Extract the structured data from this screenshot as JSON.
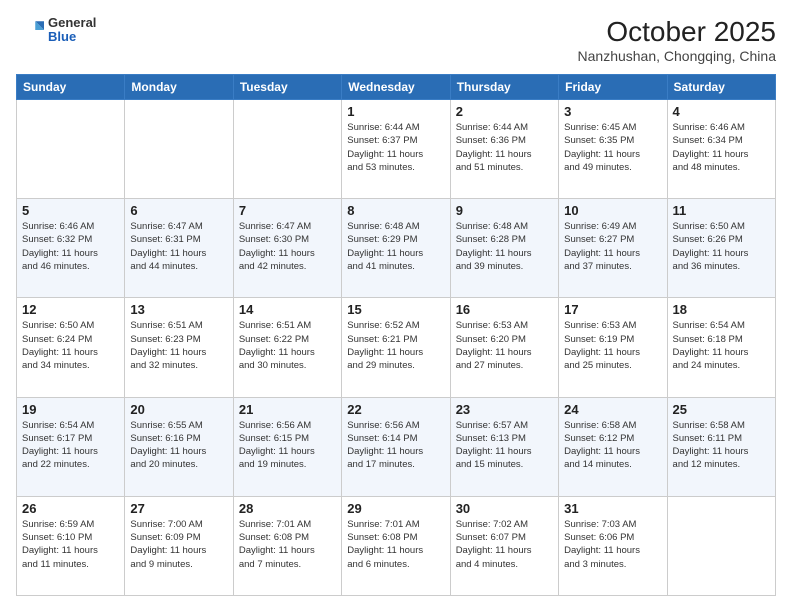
{
  "header": {
    "logo": {
      "general": "General",
      "blue": "Blue"
    },
    "title": "October 2025",
    "subtitle": "Nanzhushan, Chongqing, China"
  },
  "weekdays": [
    "Sunday",
    "Monday",
    "Tuesday",
    "Wednesday",
    "Thursday",
    "Friday",
    "Saturday"
  ],
  "weeks": [
    [
      {
        "day": "",
        "info": ""
      },
      {
        "day": "",
        "info": ""
      },
      {
        "day": "",
        "info": ""
      },
      {
        "day": "1",
        "info": "Sunrise: 6:44 AM\nSunset: 6:37 PM\nDaylight: 11 hours\nand 53 minutes."
      },
      {
        "day": "2",
        "info": "Sunrise: 6:44 AM\nSunset: 6:36 PM\nDaylight: 11 hours\nand 51 minutes."
      },
      {
        "day": "3",
        "info": "Sunrise: 6:45 AM\nSunset: 6:35 PM\nDaylight: 11 hours\nand 49 minutes."
      },
      {
        "day": "4",
        "info": "Sunrise: 6:46 AM\nSunset: 6:34 PM\nDaylight: 11 hours\nand 48 minutes."
      }
    ],
    [
      {
        "day": "5",
        "info": "Sunrise: 6:46 AM\nSunset: 6:32 PM\nDaylight: 11 hours\nand 46 minutes."
      },
      {
        "day": "6",
        "info": "Sunrise: 6:47 AM\nSunset: 6:31 PM\nDaylight: 11 hours\nand 44 minutes."
      },
      {
        "day": "7",
        "info": "Sunrise: 6:47 AM\nSunset: 6:30 PM\nDaylight: 11 hours\nand 42 minutes."
      },
      {
        "day": "8",
        "info": "Sunrise: 6:48 AM\nSunset: 6:29 PM\nDaylight: 11 hours\nand 41 minutes."
      },
      {
        "day": "9",
        "info": "Sunrise: 6:48 AM\nSunset: 6:28 PM\nDaylight: 11 hours\nand 39 minutes."
      },
      {
        "day": "10",
        "info": "Sunrise: 6:49 AM\nSunset: 6:27 PM\nDaylight: 11 hours\nand 37 minutes."
      },
      {
        "day": "11",
        "info": "Sunrise: 6:50 AM\nSunset: 6:26 PM\nDaylight: 11 hours\nand 36 minutes."
      }
    ],
    [
      {
        "day": "12",
        "info": "Sunrise: 6:50 AM\nSunset: 6:24 PM\nDaylight: 11 hours\nand 34 minutes."
      },
      {
        "day": "13",
        "info": "Sunrise: 6:51 AM\nSunset: 6:23 PM\nDaylight: 11 hours\nand 32 minutes."
      },
      {
        "day": "14",
        "info": "Sunrise: 6:51 AM\nSunset: 6:22 PM\nDaylight: 11 hours\nand 30 minutes."
      },
      {
        "day": "15",
        "info": "Sunrise: 6:52 AM\nSunset: 6:21 PM\nDaylight: 11 hours\nand 29 minutes."
      },
      {
        "day": "16",
        "info": "Sunrise: 6:53 AM\nSunset: 6:20 PM\nDaylight: 11 hours\nand 27 minutes."
      },
      {
        "day": "17",
        "info": "Sunrise: 6:53 AM\nSunset: 6:19 PM\nDaylight: 11 hours\nand 25 minutes."
      },
      {
        "day": "18",
        "info": "Sunrise: 6:54 AM\nSunset: 6:18 PM\nDaylight: 11 hours\nand 24 minutes."
      }
    ],
    [
      {
        "day": "19",
        "info": "Sunrise: 6:54 AM\nSunset: 6:17 PM\nDaylight: 11 hours\nand 22 minutes."
      },
      {
        "day": "20",
        "info": "Sunrise: 6:55 AM\nSunset: 6:16 PM\nDaylight: 11 hours\nand 20 minutes."
      },
      {
        "day": "21",
        "info": "Sunrise: 6:56 AM\nSunset: 6:15 PM\nDaylight: 11 hours\nand 19 minutes."
      },
      {
        "day": "22",
        "info": "Sunrise: 6:56 AM\nSunset: 6:14 PM\nDaylight: 11 hours\nand 17 minutes."
      },
      {
        "day": "23",
        "info": "Sunrise: 6:57 AM\nSunset: 6:13 PM\nDaylight: 11 hours\nand 15 minutes."
      },
      {
        "day": "24",
        "info": "Sunrise: 6:58 AM\nSunset: 6:12 PM\nDaylight: 11 hours\nand 14 minutes."
      },
      {
        "day": "25",
        "info": "Sunrise: 6:58 AM\nSunset: 6:11 PM\nDaylight: 11 hours\nand 12 minutes."
      }
    ],
    [
      {
        "day": "26",
        "info": "Sunrise: 6:59 AM\nSunset: 6:10 PM\nDaylight: 11 hours\nand 11 minutes."
      },
      {
        "day": "27",
        "info": "Sunrise: 7:00 AM\nSunset: 6:09 PM\nDaylight: 11 hours\nand 9 minutes."
      },
      {
        "day": "28",
        "info": "Sunrise: 7:01 AM\nSunset: 6:08 PM\nDaylight: 11 hours\nand 7 minutes."
      },
      {
        "day": "29",
        "info": "Sunrise: 7:01 AM\nSunset: 6:08 PM\nDaylight: 11 hours\nand 6 minutes."
      },
      {
        "day": "30",
        "info": "Sunrise: 7:02 AM\nSunset: 6:07 PM\nDaylight: 11 hours\nand 4 minutes."
      },
      {
        "day": "31",
        "info": "Sunrise: 7:03 AM\nSunset: 6:06 PM\nDaylight: 11 hours\nand 3 minutes."
      },
      {
        "day": "",
        "info": ""
      }
    ]
  ]
}
